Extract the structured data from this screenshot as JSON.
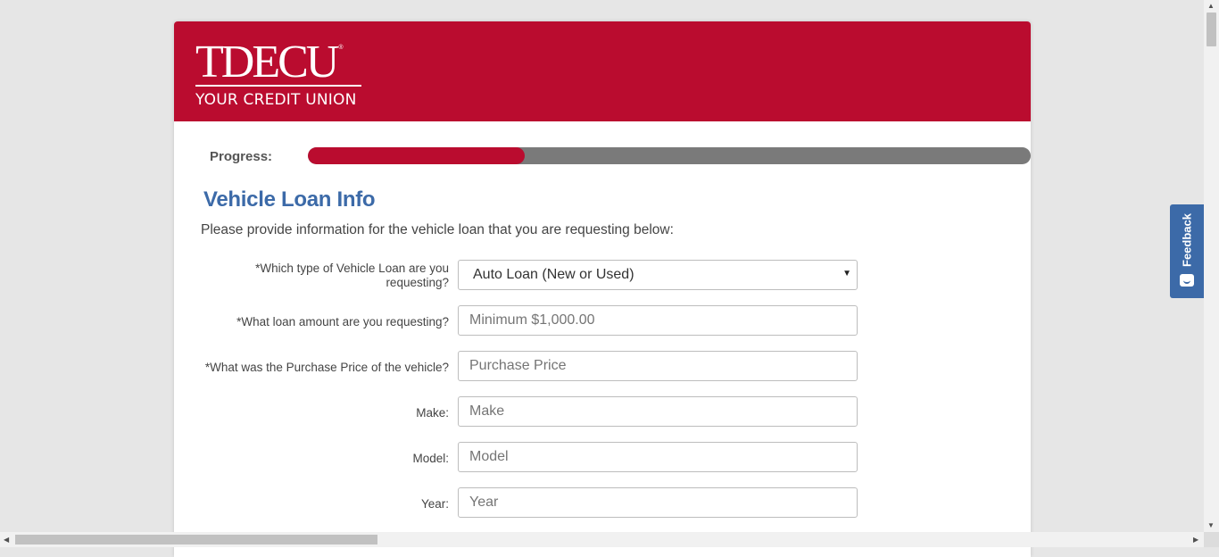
{
  "brand": {
    "logo_word": "TDECU",
    "logo_registered": "®",
    "logo_tagline": "YOUR CREDIT UNION",
    "header_color": "#ba0c2f"
  },
  "progress": {
    "label": "Progress:",
    "fraction": 0.3
  },
  "section": {
    "title": "Vehicle Loan Info",
    "intro": "Please provide information for the vehicle loan that you are requesting below:"
  },
  "fields": [
    {
      "label": "*Which type of Vehicle Loan are you requesting?",
      "type": "select",
      "value": "Auto Loan (New or Used)",
      "placeholder": ""
    },
    {
      "label": "*What loan amount are you requesting?",
      "type": "input",
      "value": "",
      "placeholder": "Minimum $1,000.00"
    },
    {
      "label": "*What was the Purchase Price of the vehicle?",
      "type": "input",
      "value": "",
      "placeholder": "Purchase Price"
    },
    {
      "label": "Make:",
      "type": "input",
      "value": "",
      "placeholder": "Make"
    },
    {
      "label": "Model:",
      "type": "input",
      "value": "",
      "placeholder": "Model"
    },
    {
      "label": "Year:",
      "type": "input",
      "value": "",
      "placeholder": "Year"
    }
  ],
  "feedback": {
    "label": "Feedback",
    "icon": "feedback-face-icon",
    "color": "#3c6aa8"
  }
}
